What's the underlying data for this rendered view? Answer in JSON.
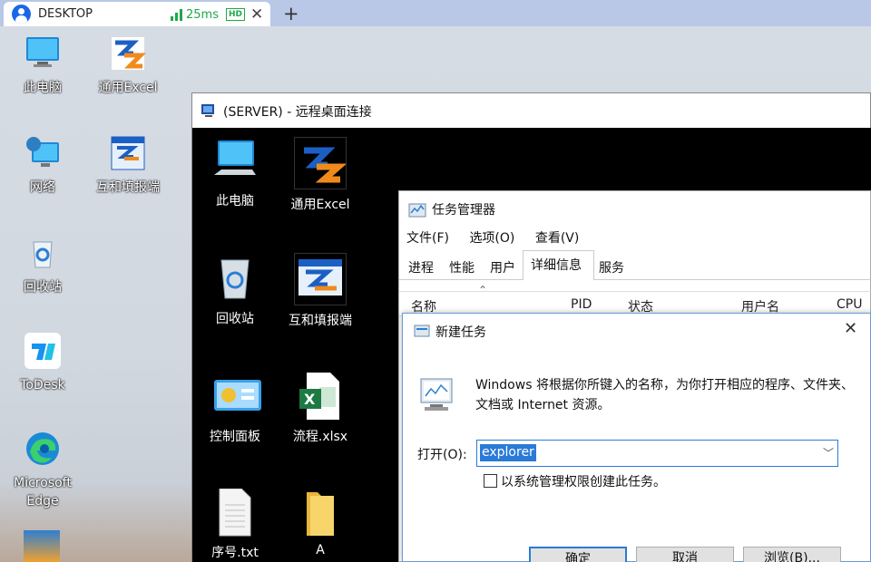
{
  "client": {
    "tab_title": "DESKTOP",
    "latency": "25ms",
    "quality_badge": "HD",
    "close_glyph": "✕",
    "new_tab_glyph": "+"
  },
  "desktop_icons": [
    {
      "label": "此电脑",
      "icon": "this-pc-icon"
    },
    {
      "label": "通用Excel",
      "icon": "excel-app-icon"
    },
    {
      "label": "网络",
      "icon": "network-icon"
    },
    {
      "label": "互和填报端",
      "icon": "report-app-icon"
    },
    {
      "label": "回收站",
      "icon": "recycle-bin-icon"
    },
    {
      "label": "ToDesk",
      "icon": "todesk-icon"
    },
    {
      "label": "Microsoft Edge",
      "icon": "edge-icon"
    }
  ],
  "remote_window": {
    "title": "(SERVER) - 远程桌面连接",
    "icons": [
      {
        "label": "此电脑"
      },
      {
        "label": "通用Excel"
      },
      {
        "label": "回收站"
      },
      {
        "label": "互和填报端"
      },
      {
        "label": "控制面板"
      },
      {
        "label": "流程.xlsx"
      },
      {
        "label": "序号.txt"
      },
      {
        "label": "A"
      }
    ]
  },
  "task_manager": {
    "title": "任务管理器",
    "menu": [
      "文件(F)",
      "选项(O)",
      "查看(V)"
    ],
    "tabs": [
      "进程",
      "性能",
      "用户",
      "详细信息",
      "服务"
    ],
    "columns": [
      "名称",
      "PID",
      "状态",
      "用户名",
      "CPU"
    ]
  },
  "run_dialog": {
    "title": "新建任务",
    "description": "Windows 将根据你所键入的名称，为你打开相应的程序、文件夹、文档或 Internet 资源。",
    "open_label": "打开(O):",
    "open_value": "explorer",
    "admin_checkbox_label": "以系统管理权限创建此任务。",
    "admin_checked": false,
    "ok_label": "确定",
    "cancel_label": "取消",
    "browse_label": "浏览(B)..."
  }
}
